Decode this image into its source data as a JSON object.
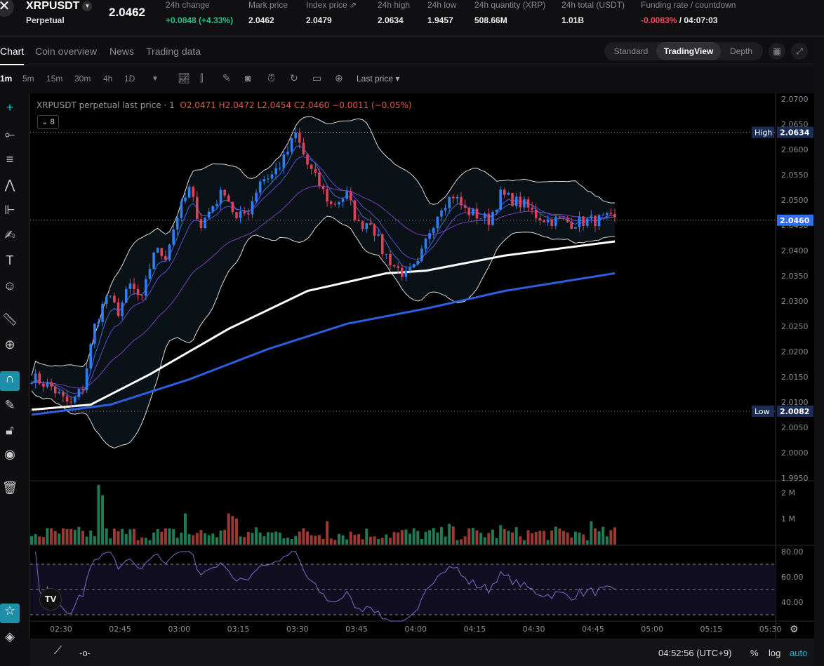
{
  "header": {
    "logo": "✕",
    "symbol": "XRPUSDT",
    "type": "Perpetual",
    "last_price": "2.0462",
    "stats": [
      {
        "label": "24h change",
        "value": "+0.0848 (+4.33%)",
        "tone": "green"
      },
      {
        "label": "Mark price",
        "value": "2.0462"
      },
      {
        "label": "Index price ⇗",
        "value": "2.0479"
      },
      {
        "label": "24h high",
        "value": "2.0634"
      },
      {
        "label": "24h low",
        "value": "1.9457"
      },
      {
        "label": "24h quantity (XRP)",
        "value": "508.66M"
      },
      {
        "label": "24h total (USDT)",
        "value": "1.01B"
      },
      {
        "label": "Funding rate / countdown",
        "value": "-0.0083%",
        "value2": " / 04:07:03",
        "tone": "red"
      }
    ]
  },
  "tabs": [
    "Chart",
    "Coin overview",
    "News",
    "Trading data"
  ],
  "views": [
    "Standard",
    "TradingView",
    "Depth"
  ],
  "timeframes": [
    "1m",
    "5m",
    "15m",
    "30m",
    "4h",
    "1D"
  ],
  "price_type": "Last price ▾",
  "legend": {
    "title": "XRPUSDT perpetual last price · 1",
    "o": "O2.0471",
    "h": "H2.0472",
    "l": "L2.0454",
    "c": "C2.0460",
    "chg": "−0.0011 (−0.05%)",
    "indicators": "⌄ 8"
  },
  "colors": {
    "up": "#2f7ff0",
    "down": "#e0405a",
    "vol_up": "#1f7a55",
    "vol_down": "#9a3a32",
    "ma_fast": "#ffffff",
    "ma_slow": "#2d5fe0",
    "rsi": "#7e6cc9"
  },
  "chart_data": {
    "type": "candlestick",
    "y_ticks": [
      "2.0700",
      "2.0650",
      "2.0600",
      "2.0550",
      "2.0500",
      "2.0450",
      "2.0400",
      "2.0350",
      "2.0300",
      "2.0250",
      "2.0200",
      "2.0150",
      "2.0100",
      "2.0050",
      "2.0000",
      "1.9950"
    ],
    "ylim": [
      1.995,
      2.07
    ],
    "x_ticks": [
      "02:30",
      "02:45",
      "03:00",
      "03:15",
      "03:30",
      "03:45",
      "04:00",
      "04:15",
      "04:30",
      "04:45",
      "05:00",
      "05:15",
      "05:30"
    ],
    "start_time": "02:23",
    "bars": 149,
    "close_keypoints": [
      [
        0,
        2.015
      ],
      [
        5,
        2.013
      ],
      [
        8,
        2.0105
      ],
      [
        10,
        2.0095
      ],
      [
        13,
        2.013
      ],
      [
        16,
        2.025
      ],
      [
        19,
        2.031
      ],
      [
        22,
        2.028
      ],
      [
        25,
        2.033
      ],
      [
        28,
        2.03
      ],
      [
        31,
        2.04
      ],
      [
        34,
        2.039
      ],
      [
        37,
        2.047
      ],
      [
        40,
        2.052
      ],
      [
        43,
        2.045
      ],
      [
        46,
        2.049
      ],
      [
        49,
        2.052
      ],
      [
        52,
        2.046
      ],
      [
        55,
        2.048
      ],
      [
        58,
        2.054
      ],
      [
        61,
        2.055
      ],
      [
        64,
        2.058
      ],
      [
        67,
        2.063
      ],
      [
        70,
        2.057
      ],
      [
        73,
        2.053
      ],
      [
        76,
        2.049
      ],
      [
        80,
        2.051
      ],
      [
        83,
        2.045
      ],
      [
        86,
        2.046
      ],
      [
        89,
        2.04
      ],
      [
        92,
        2.037
      ],
      [
        95,
        2.035
      ],
      [
        98,
        2.037
      ],
      [
        101,
        2.044
      ],
      [
        104,
        2.049
      ],
      [
        107,
        2.051
      ],
      [
        110,
        2.048
      ],
      [
        113,
        2.047
      ],
      [
        116,
        2.046
      ],
      [
        119,
        2.051
      ],
      [
        122,
        2.05
      ],
      [
        125,
        2.049
      ],
      [
        128,
        2.047
      ],
      [
        131,
        2.046
      ],
      [
        134,
        2.046
      ],
      [
        137,
        2.0455
      ],
      [
        140,
        2.0458
      ],
      [
        143,
        2.046
      ],
      [
        146,
        2.0462
      ],
      [
        148,
        2.046
      ]
    ],
    "ma_fast_keypoints": [
      [
        0,
        2.0085
      ],
      [
        15,
        2.0095
      ],
      [
        30,
        2.0155
      ],
      [
        50,
        2.0245
      ],
      [
        70,
        2.032
      ],
      [
        90,
        2.0355
      ],
      [
        100,
        2.036
      ],
      [
        120,
        2.039
      ],
      [
        148,
        2.0418
      ]
    ],
    "ma_slow_keypoints": [
      [
        0,
        2.0075
      ],
      [
        20,
        2.0095
      ],
      [
        40,
        2.0145
      ],
      [
        60,
        2.0205
      ],
      [
        80,
        2.0255
      ],
      [
        100,
        2.0285
      ],
      [
        120,
        2.032
      ],
      [
        148,
        2.0355
      ]
    ],
    "high_label": "High",
    "high": "2.0634",
    "low_label": "Low",
    "low": "2.0082",
    "current": "2.0460",
    "volume": {
      "ticks": [
        "2 M",
        "1 M"
      ],
      "max": 2.4,
      "spikes": [
        [
          17,
          2.3
        ],
        [
          18,
          1.9
        ],
        [
          39,
          1.2
        ],
        [
          50,
          1.2
        ],
        [
          51,
          1.1
        ],
        [
          52,
          1.0
        ],
        [
          75,
          0.9
        ],
        [
          106,
          0.8
        ],
        [
          119,
          0.75
        ],
        [
          142,
          0.9
        ]
      ]
    },
    "rsi": {
      "ticks": [
        "80.00",
        "60.00",
        "40.00"
      ],
      "period": 14,
      "bands": [
        70,
        50,
        30
      ]
    }
  },
  "footer": {
    "time": "04:52:56 (UTC+9)",
    "pct": "%",
    "log": "log",
    "auto": "auto"
  }
}
